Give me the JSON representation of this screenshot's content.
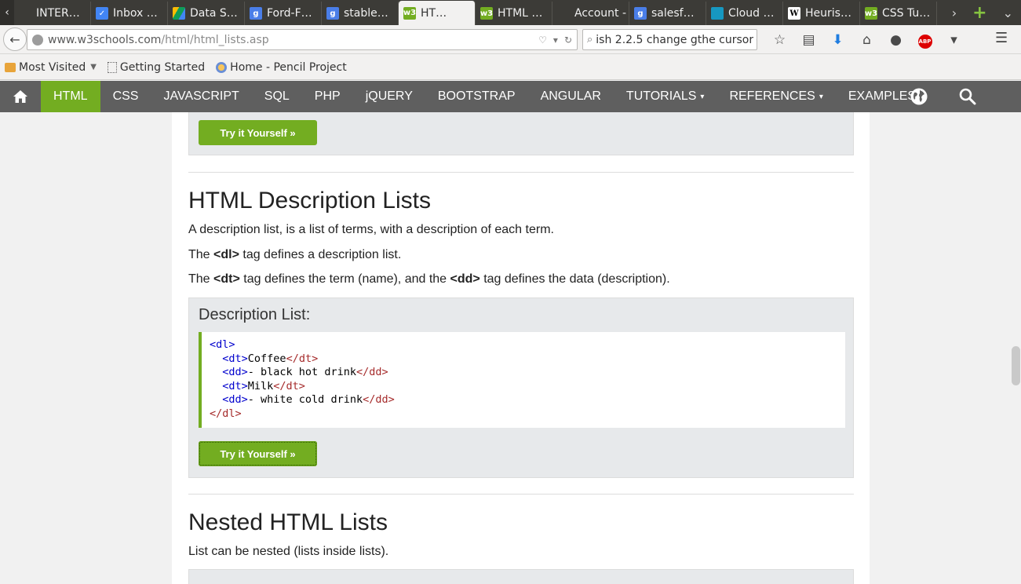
{
  "browser": {
    "tabs": [
      {
        "label": "INTER…",
        "favicon": "blank"
      },
      {
        "label": "Inbox …",
        "favicon": "inbox"
      },
      {
        "label": "Data S…",
        "favicon": "drive"
      },
      {
        "label": "Ford-F…",
        "favicon": "google"
      },
      {
        "label": "stable…",
        "favicon": "google"
      },
      {
        "label": "HT…",
        "favicon": "w3",
        "active": true
      },
      {
        "label": "HTML …",
        "favicon": "w3"
      },
      {
        "label": "Account - …",
        "favicon": "blank"
      },
      {
        "label": "salesf…",
        "favicon": "google"
      },
      {
        "label": "Cloud …",
        "favicon": "salesforce"
      },
      {
        "label": "Heuris…",
        "favicon": "wikipedia"
      },
      {
        "label": "CSS Tu…",
        "favicon": "w3"
      }
    ],
    "url_host": "www.w3schools.com",
    "url_path": "/html/html_lists.asp",
    "search_value": "ish 2.2.5 change gthe cursor",
    "bookmarks": [
      {
        "label": "Most Visited",
        "icon": "folder-icon",
        "dropdown": true
      },
      {
        "label": "Getting Started",
        "icon": "page-icon"
      },
      {
        "label": "Home - Pencil Project",
        "icon": "pencil-project-icon"
      }
    ]
  },
  "sitenav": {
    "items": [
      {
        "label": "HTML",
        "active": true
      },
      {
        "label": "CSS"
      },
      {
        "label": "JAVASCRIPT"
      },
      {
        "label": "SQL"
      },
      {
        "label": "PHP"
      },
      {
        "label": "jQUERY"
      },
      {
        "label": "BOOTSTRAP"
      },
      {
        "label": "ANGULAR"
      },
      {
        "label": "TUTORIALS",
        "dropdown": true
      },
      {
        "label": "REFERENCES",
        "dropdown": true
      },
      {
        "label": "EXAMPLES",
        "dropdown": true
      }
    ],
    "dropdown_glyph": "▾"
  },
  "content": {
    "try_label": "Try it Yourself »",
    "desc_heading": "HTML Description Lists",
    "desc_p1": "A description list, is a list of terms, with a description of each term.",
    "desc_p2_pre": "The ",
    "desc_p2_tag": "<dl>",
    "desc_p2_post": " tag defines a description list.",
    "desc_p3_pre": "The ",
    "desc_p3_tag1": "<dt>",
    "desc_p3_mid": " tag defines the term (name), and the ",
    "desc_p3_tag2": "<dd>",
    "desc_p3_post": " tag defines the data (description).",
    "example_title": "Description List:",
    "code": {
      "l1_open": "<dl>",
      "l2_open": "<dt>",
      "l2_text": "Coffee",
      "l2_close": "</dt>",
      "l3_open": "<dd>",
      "l3_text": "- black hot drink",
      "l3_close": "</dd>",
      "l4_open": "<dt>",
      "l4_text": "Milk",
      "l4_close": "</dt>",
      "l5_open": "<dd>",
      "l5_text": "- white cold drink",
      "l5_close": "</dd>",
      "l6_close": "</dl>"
    },
    "nested_heading": "Nested HTML Lists",
    "nested_p1": "List can be nested (lists inside lists)."
  },
  "colors": {
    "accent": "#73ad21",
    "nav_bg": "#5f5f5f",
    "code_tag": "#0000cd",
    "code_tag_close": "#a52a2a"
  }
}
